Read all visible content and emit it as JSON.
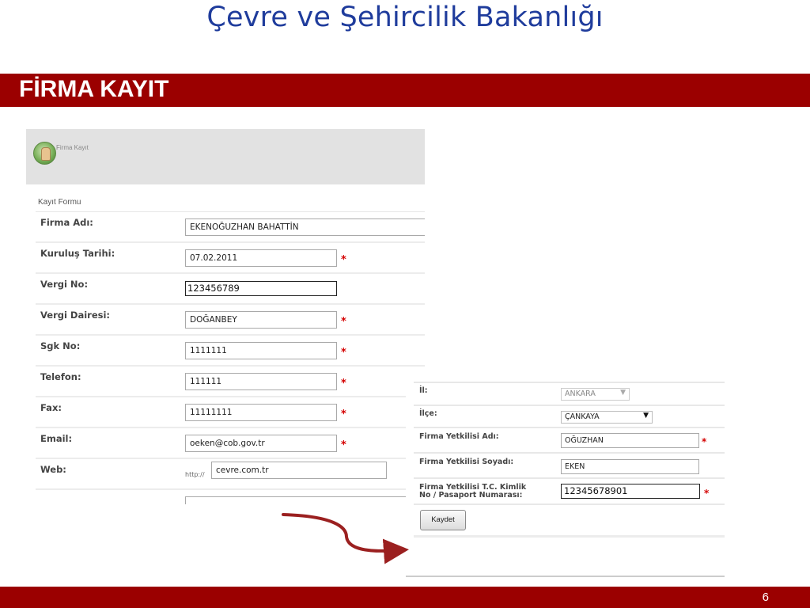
{
  "slide": {
    "title": "Çevre ve Şehircilik Bakanlığı",
    "section": "FİRMA KAYIT",
    "page_number": "6"
  },
  "left_form": {
    "header_label": "Firma Kayıt",
    "caption": "Kayıt Formu",
    "fields": {
      "firma_adi": {
        "label": "Firma Adı:",
        "value": "EKENOĞUZHAN BAHATTİN"
      },
      "kurulus_tarihi": {
        "label": "Kuruluş Tarihi:",
        "value": "07.02.2011"
      },
      "vergi_no": {
        "label": "Vergi No:",
        "value": "123456789"
      },
      "vergi_dairesi": {
        "label": "Vergi Dairesi:",
        "value": "DOĞANBEY"
      },
      "sgk_no": {
        "label": "Sgk No:",
        "value": "1111111"
      },
      "telefon": {
        "label": "Telefon:",
        "value": "111111"
      },
      "fax": {
        "label": "Fax:",
        "value": "11111111"
      },
      "email": {
        "label": "Email:",
        "value": "oeken@cob.gov.tr"
      },
      "web": {
        "label": "Web:",
        "prefix": "http://",
        "value": "cevre.com.tr"
      }
    },
    "required_mark": "*"
  },
  "right_form": {
    "fields": {
      "il": {
        "label": "İl:",
        "value": "ANKARA"
      },
      "ilce": {
        "label": "İlçe:",
        "value": "ÇANKAYA"
      },
      "yetkili_adi": {
        "label": "Firma Yetkilisi Adı:",
        "value": "OĞUZHAN"
      },
      "yetkili_soyadi": {
        "label": "Firma Yetkilisi Soyadı:",
        "value": "EKEN"
      },
      "kimlik_no": {
        "label_line1": "Firma Yetkilisi T.C. Kimlik",
        "label_line2": "No / Pasaport Numarası:",
        "value": "12345678901"
      }
    },
    "save_label": "Kaydet",
    "required_mark": "*"
  },
  "colors": {
    "title_blue": "#1f3c9c",
    "banner_red": "#9b0000",
    "arrow_red": "#9b2020",
    "required_red": "#d40000"
  }
}
